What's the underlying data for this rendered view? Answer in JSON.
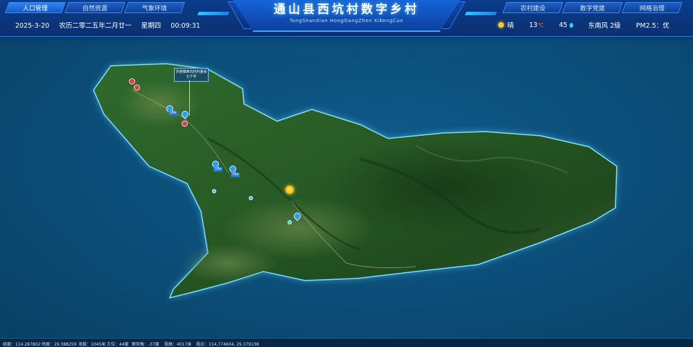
{
  "nav_left": [
    {
      "label": "人口管理",
      "active": true
    },
    {
      "label": "自然资源",
      "active": false
    },
    {
      "label": "气象环境",
      "active": false
    }
  ],
  "nav_right": [
    {
      "label": "农村建设",
      "active": false
    },
    {
      "label": "数字党建",
      "active": false
    },
    {
      "label": "网格治理",
      "active": false
    }
  ],
  "header": {
    "title": "通山县西坑村数字乡村",
    "subtitle": "TongShanXian HongGangZhen XiKengCun"
  },
  "datetime": {
    "date": "2025-3-20",
    "lunar": "农历二零二五年二月廿一",
    "weekday": "星期四",
    "time": "00:09:31"
  },
  "weather": {
    "condition": "晴",
    "temperature": "13",
    "temperature_unit": "℃",
    "humidity": "45",
    "wind": "东南风 2级",
    "air_quality": "PM2.5：优",
    "icons": [
      "sun-icon",
      "water-drop-icon"
    ]
  },
  "map": {
    "callout_lines": [
      "洪港镇西坑村村委会",
      "七十字"
    ],
    "pins": [
      {
        "label": "18e"
      },
      {
        "label": "18e"
      },
      {
        "label": "18e"
      }
    ],
    "colors": {
      "terrain": "#2e5a26",
      "glow": "#5fd3ff",
      "sea": "#0b4d78"
    }
  },
  "status": {
    "longitude": "经度：114.287802",
    "latitude": "纬度：29.388259",
    "elevation": "海拔：1045米",
    "heading": "方位：44度",
    "pitch": "俯仰角：-37度",
    "distance": "视高：4017米",
    "camera": "视点：114.774604, 29.379138"
  }
}
